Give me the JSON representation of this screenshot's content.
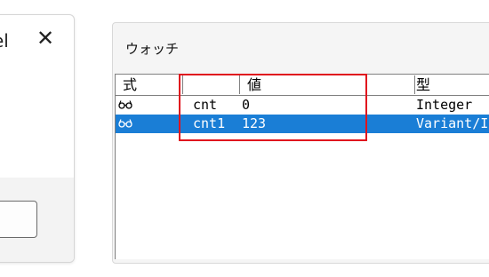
{
  "left_dialog": {
    "partial_title": "el",
    "close_glyph": "✕"
  },
  "watch": {
    "title": "ウォッチ",
    "columns": {
      "expression": "式",
      "value": "値",
      "type": "型"
    },
    "rows": [
      {
        "icon": "watch-glasses-icon",
        "expression": "cnt",
        "value": "0",
        "type": "Integer",
        "selected": false
      },
      {
        "icon": "watch-glasses-icon",
        "expression": "cnt1",
        "value": "123",
        "type": "Variant/I",
        "selected": true
      }
    ]
  },
  "colors": {
    "selection": "#1a7ed6",
    "highlight_box": "#e0141e"
  }
}
